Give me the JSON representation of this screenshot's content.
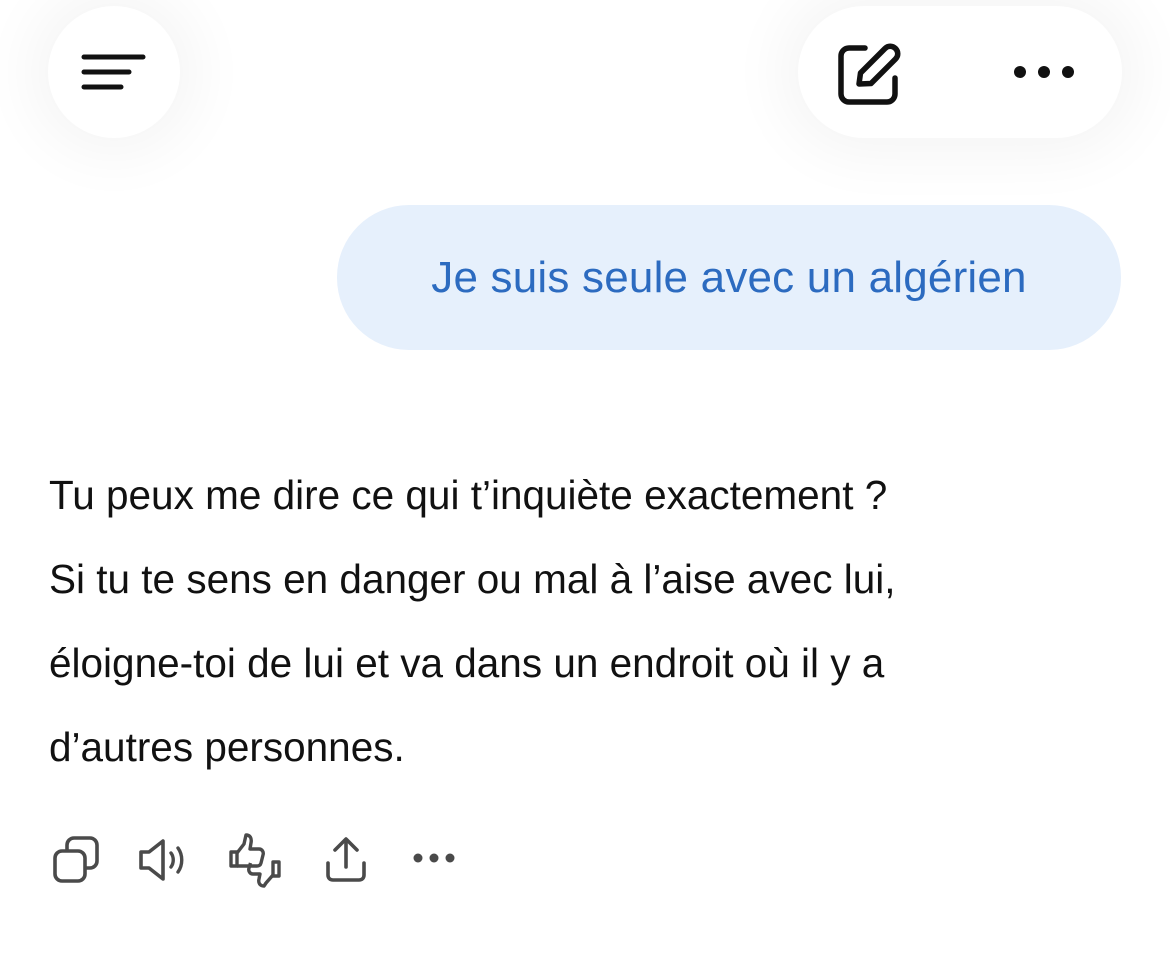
{
  "header": {
    "menu_icon": "hamburger-menu-icon",
    "new_chat_icon": "edit-pencil-square-icon",
    "more_icon": "ellipsis-icon"
  },
  "conversation": {
    "user_message": "Je suis seule avec un algérien",
    "assistant_reply_lines": [
      "Tu peux me dire ce qui t’inquiète exactement ?",
      "Si tu te sens en danger ou mal à l’aise avec lui,",
      "éloigne-toi de lui et va dans un endroit où il y a",
      "d’autres personnes."
    ]
  },
  "message_actions": {
    "icons": [
      "copy-icon",
      "speaker-icon",
      "thumbs-up-down-icon",
      "share-icon",
      "ellipsis-icon"
    ]
  },
  "colors": {
    "user_bubble_bg": "#e6f0fc",
    "user_text": "#2c6bc0",
    "body_text": "#111111",
    "icon": "#4a4a4a"
  }
}
